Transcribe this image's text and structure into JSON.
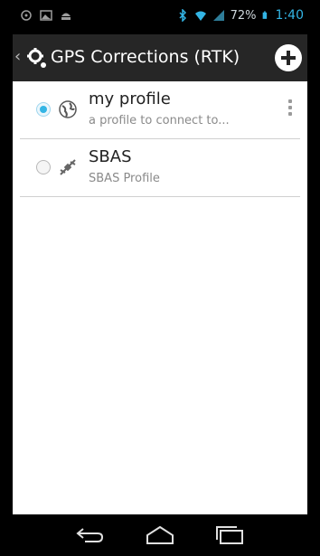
{
  "status_bar": {
    "battery_percent": "72%",
    "time": "1:40",
    "left_icons": [
      "sync-icon",
      "image-icon",
      "android-icon"
    ],
    "right_icons": [
      "bluetooth-icon",
      "wifi-icon",
      "signal-icon",
      "battery-icon"
    ]
  },
  "action_bar": {
    "title": "GPS Corrections (RTK)",
    "add_icon": "add-circle-icon",
    "logo_icon": "gear-icon"
  },
  "profiles": [
    {
      "title": "my profile",
      "subtitle": "a profile to connect to...",
      "selected": true,
      "icon": "globe-icon"
    },
    {
      "title": "SBAS",
      "subtitle": "SBAS Profile",
      "selected": false,
      "icon": "satellite-icon"
    }
  ],
  "nav_bar": {
    "buttons": [
      "back-icon",
      "home-icon",
      "recent-apps-icon"
    ]
  },
  "colors": {
    "accent": "#33b5e5",
    "action_bar": "#262626",
    "background": "#ffffff"
  }
}
